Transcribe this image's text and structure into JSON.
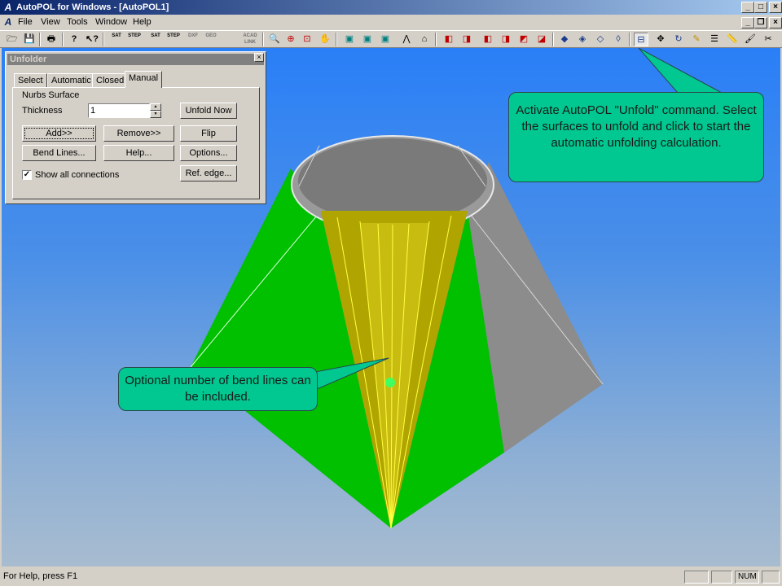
{
  "app": {
    "title": "AutoPOL for Windows - [AutoPOL1]"
  },
  "menu": {
    "items": [
      "File",
      "View",
      "Tools",
      "Window",
      "Help"
    ]
  },
  "toolbar": {
    "labels": {
      "sat1": "SAT",
      "step1": "STEP",
      "sat2": "SAT",
      "step2": "STEP",
      "dxf": "DXF",
      "geo": "GEO",
      "acad": "ACAD LINK"
    }
  },
  "unfolder": {
    "title": "Unfolder",
    "tabs": [
      "Select",
      "Automatic",
      "Closed",
      "Manual"
    ],
    "active_tab": "Manual",
    "group_label": "Nurbs Surface",
    "thickness_label": "Thickness",
    "thickness_value": "1",
    "buttons": {
      "unfold_now": "Unfold Now",
      "add": "Add>>",
      "remove": "Remove>>",
      "flip": "Flip",
      "bend_lines": "Bend Lines...",
      "help": "Help...",
      "options": "Options...",
      "ref_edge": "Ref. edge..."
    },
    "show_all_label": "Show all connections",
    "show_all_checked": true
  },
  "callouts": {
    "unfold": "Activate  AutoPOL \"Unfold\" command. Select the surfaces to unfold and click to start the automatic unfolding calculation.",
    "bend": "Optional number of bend lines can be included."
  },
  "status": {
    "help_text": "For Help, press F1",
    "num": "NUM"
  },
  "colors": {
    "green_surface": "#00c000",
    "yellow_surface": "#b8ac00",
    "gray_surface": "#8a8a8a",
    "callout": "#00c890"
  }
}
